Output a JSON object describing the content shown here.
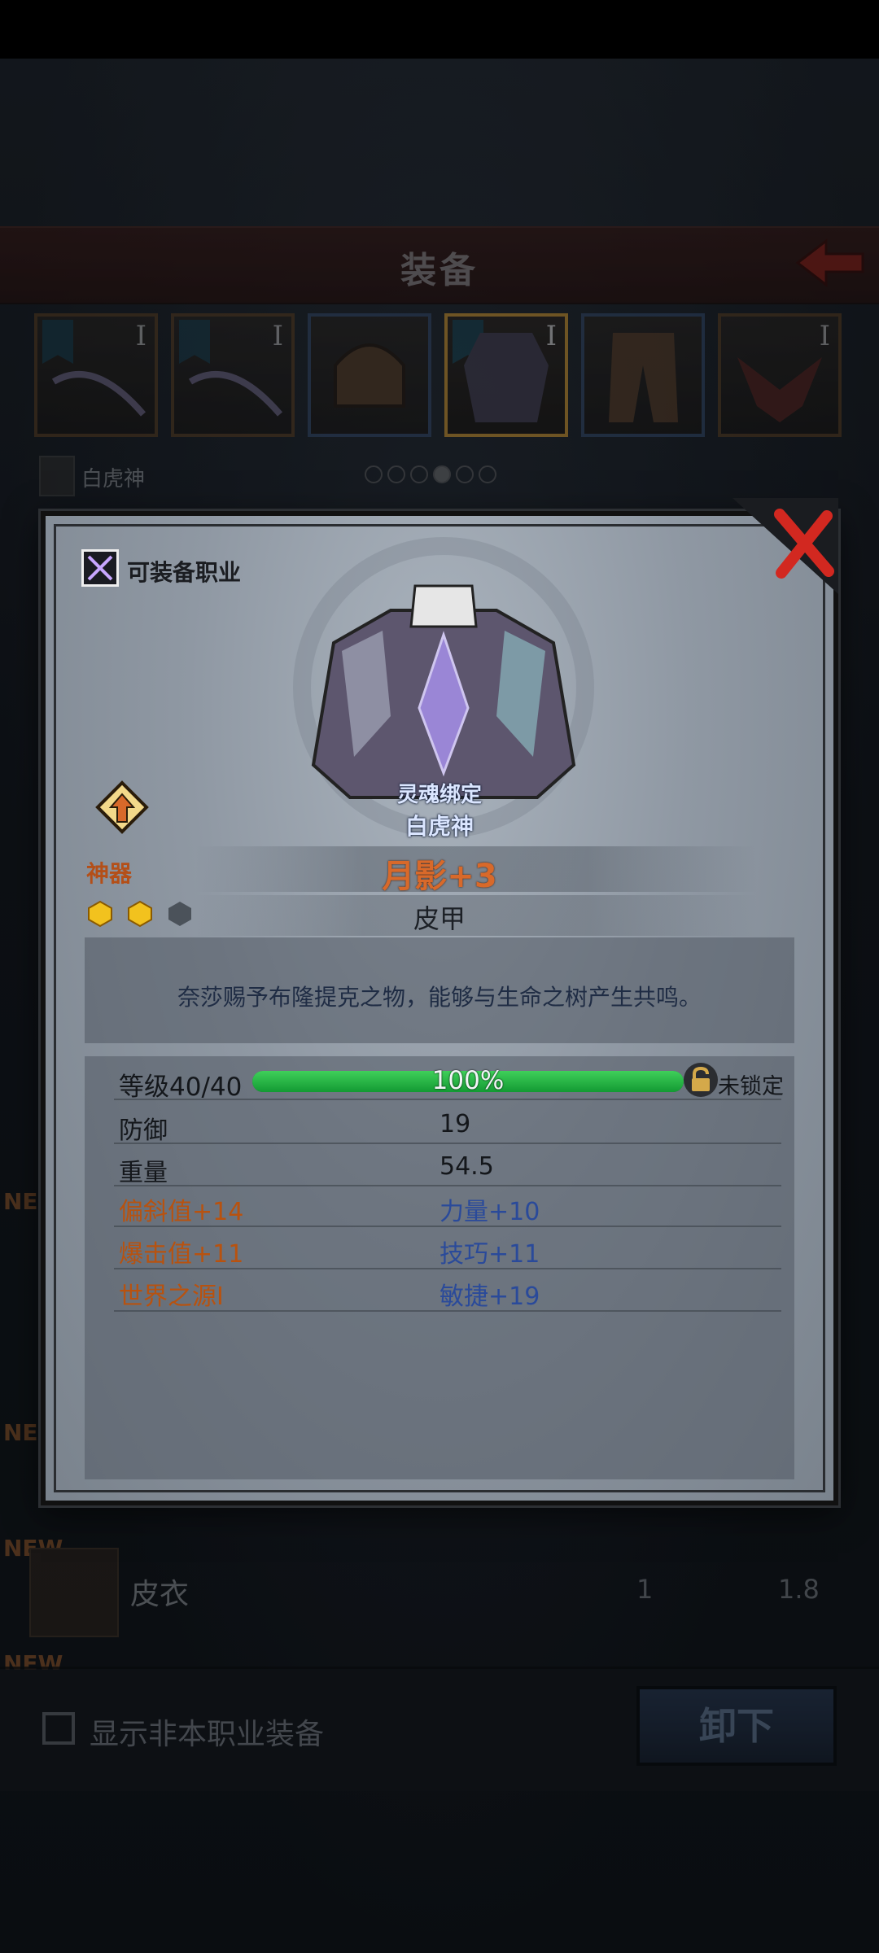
{
  "header": {
    "title": "装备"
  },
  "character": {
    "name": "白虎神"
  },
  "slots": [
    {
      "label": "I",
      "rarity": "orange",
      "icon": "bow-icon"
    },
    {
      "label": "I",
      "rarity": "orange",
      "icon": "bow-icon"
    },
    {
      "label": "",
      "rarity": "blue",
      "icon": "helmet-icon"
    },
    {
      "label": "I",
      "rarity": "orange",
      "icon": "armor-icon",
      "selected": true
    },
    {
      "label": "",
      "rarity": "blue",
      "icon": "leggings-icon"
    },
    {
      "label": "I",
      "rarity": "orange",
      "icon": "amulet-icon"
    }
  ],
  "list": [
    {
      "tag": "NEW"
    },
    {
      "tag": "NEW"
    },
    {
      "tag": "NEW",
      "name": "皮衣",
      "v1": "1",
      "v2": "1.8"
    },
    {
      "tag": "NEW"
    }
  ],
  "footer": {
    "checkbox_label": "显示非本职业装备",
    "unequip_label": "卸下"
  },
  "modal": {
    "job_label": "可装备职业",
    "bind_line1": "灵魂绑定",
    "bind_line2": "白虎神",
    "category": "神器",
    "item_name": "月影+3",
    "item_type": "皮甲",
    "stars_filled": 2,
    "stars_total": 3,
    "description": "奈莎赐予布隆提克之物，能够与生命之树产生共鸣。",
    "level_label": "等级40/40",
    "progress": 1.0,
    "progress_text": "100%",
    "lock_label": "未锁定",
    "stats": {
      "defense_label": "防御",
      "defense_value": "19",
      "weight_label": "重量",
      "weight_value": "54.5",
      "bias": "偏斜值+14",
      "strength": "力量+10",
      "crit": "爆击值+11",
      "skill": "技巧+11",
      "world": "世界之源I",
      "agility": "敏捷+19"
    }
  },
  "colors": {
    "accent_orange": "#d8692a",
    "stat_blue": "#2a4a9a",
    "progress_green": "#2fbf4c"
  }
}
